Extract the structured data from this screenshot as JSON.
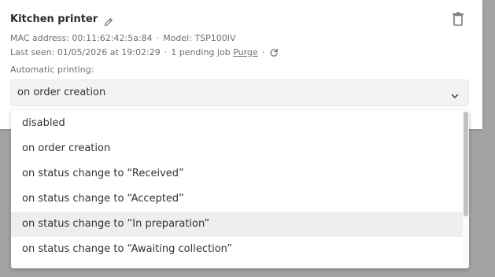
{
  "printer": {
    "name": "Kitchen printer",
    "mac_address": "MAC address: 00:11:62:42:5a:84",
    "model": "Model: TSP100IV",
    "last_seen": "Last seen: 01/05/2026 at 19:02:29",
    "pending_jobs": "1 pending job",
    "purge_label": "Purge",
    "separator": "·"
  },
  "automatic_printing": {
    "label": "Automatic printing:",
    "selected": "on order creation",
    "options": [
      "disabled",
      "on order creation",
      "on status change to “Received”",
      "on status change to “Accepted”",
      "on status change to “In preparation”",
      "on status change to “Awaiting collection”"
    ],
    "highlighted_index": 4
  },
  "icons": {
    "edit": "pencil-icon",
    "delete": "trash-icon",
    "refresh": "refresh-icon",
    "dropdown": "chevron-down-icon"
  },
  "colors": {
    "overlay": "#a3a3a3",
    "card": "#ffffff",
    "select_bg": "#f3f3f3",
    "highlight": "#eeeeee",
    "text": "#333333",
    "muted": "#6f6f6f"
  }
}
